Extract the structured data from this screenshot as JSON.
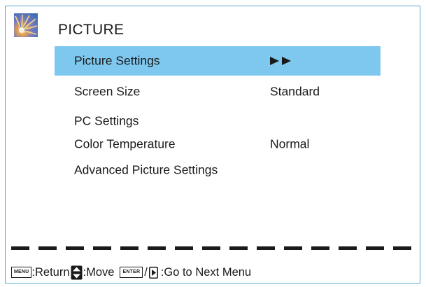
{
  "menu": {
    "title": "PICTURE",
    "icon": "picture-thumbnail-icon",
    "items": [
      {
        "label": "Picture Settings",
        "value": "",
        "arrows": "►►",
        "selected": true
      },
      {
        "label": "Screen Size",
        "value": "Standard",
        "selected": false
      },
      {
        "label": "PC Settings",
        "value": "",
        "selected": false
      },
      {
        "label": "Color Temperature",
        "value": "Normal",
        "selected": false
      },
      {
        "label": "Advanced Picture Settings",
        "value": "",
        "selected": false
      }
    ]
  },
  "footer": {
    "menu_key": "MENU",
    "return_text": ":Return",
    "move_icon": "up-down-arrow-icon",
    "move_text": ":Move",
    "enter_key": "ENTER",
    "separator": "/",
    "right_icon": "right-arrow-icon",
    "next_text": ":Go to Next Menu"
  },
  "colors": {
    "selected_bg": "#7ec8f0",
    "border": "#58a6d4",
    "text": "#1a1a1a"
  }
}
